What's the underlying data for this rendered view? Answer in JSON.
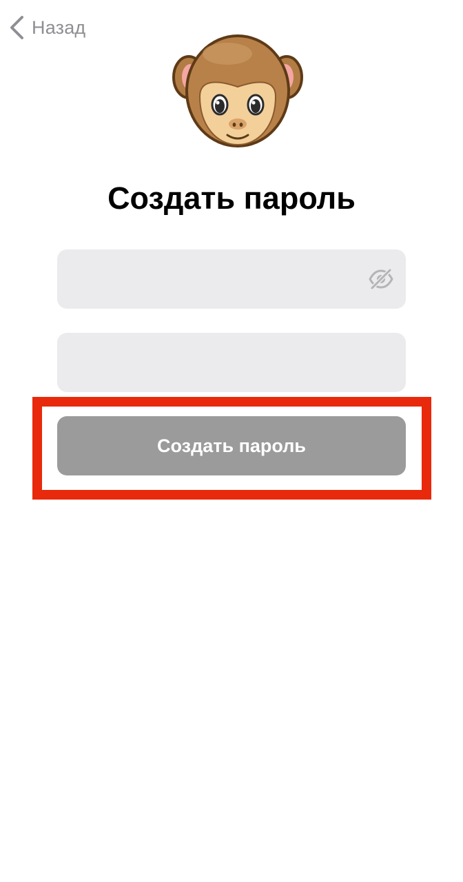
{
  "nav": {
    "back_label": "Назад"
  },
  "mascot": {
    "icon": "monkey-face-icon"
  },
  "page_title": "Создать пароль",
  "form": {
    "password_field": {
      "value": "",
      "placeholder": "",
      "toggle_icon": "eye-slash-icon"
    },
    "confirm_field": {
      "value": "",
      "placeholder": ""
    },
    "submit_label": "Создать пароль"
  },
  "colors": {
    "highlight": "#e8290b",
    "button_disabled": "#9b9b9b",
    "field_bg": "#ebebed",
    "secondary_text": "#8e8e93"
  }
}
